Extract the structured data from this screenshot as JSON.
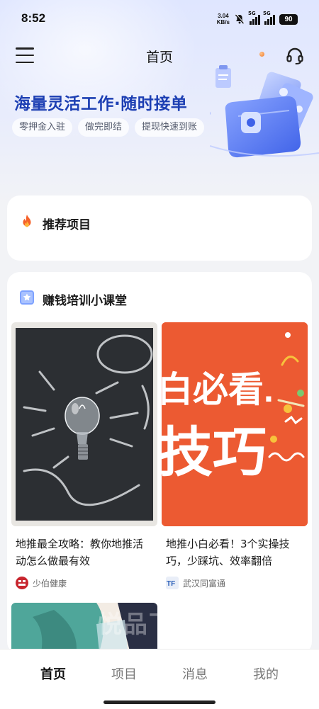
{
  "status_bar": {
    "time": "8:52",
    "net_speed_value": "3.04",
    "net_speed_unit": "KB/s",
    "signal1_label": "5G",
    "signal2_label": "5G",
    "battery": "90"
  },
  "nav": {
    "title": "首页",
    "menu_icon": "hamburger-menu-icon",
    "support_icon": "headset-icon"
  },
  "banner": {
    "title": "海量灵活工作·随时接单",
    "tags": [
      "零押金入驻",
      "做完即结",
      "提现快速到账"
    ]
  },
  "recommend": {
    "icon": "fire-icon",
    "title": "推荐项目"
  },
  "training": {
    "icon": "book-star-icon",
    "title": "赚钱培训小课堂",
    "articles": [
      {
        "title": "地推最全攻略：教你地推活动怎么做最有效",
        "source": "少伯健康",
        "image": "light-bulb-chalkboard"
      },
      {
        "title": "地推小白必看！3个实操技巧，少踩坑、效率翻倍",
        "source": "武汉同富通",
        "image_text_line1": "白必看.",
        "image_text_line2": "技巧"
      }
    ]
  },
  "watermark": "悦品下载",
  "tabbar": {
    "tabs": [
      "首页",
      "项目",
      "消息",
      "我的"
    ],
    "active_index": 0
  },
  "colors": {
    "brand_blue": "#1d3fb3",
    "orange_thumb": "#ec5a32",
    "page_bg": "#f2f3f6"
  }
}
